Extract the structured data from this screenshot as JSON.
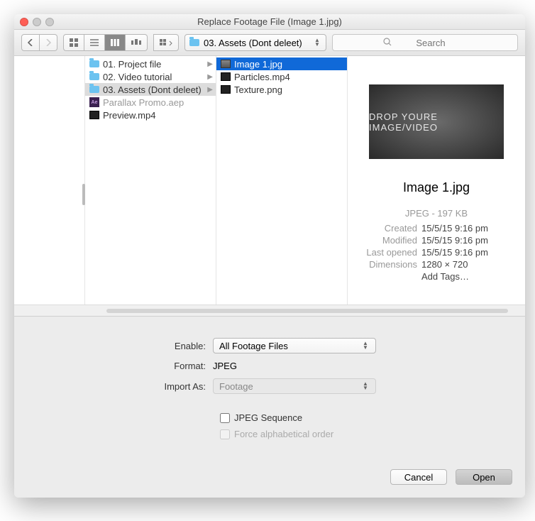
{
  "window": {
    "title": "Replace Footage File (Image 1.jpg)"
  },
  "toolbar": {
    "path_label": "03. Assets (Dont deleet)",
    "search_placeholder": "Search"
  },
  "cols": {
    "c1": {
      "items": [
        {
          "label": "01. Project file",
          "type": "folder"
        },
        {
          "label": "02. Video tutorial",
          "type": "folder"
        },
        {
          "label": "03. Assets (Dont deleet)",
          "type": "folder",
          "selected": true
        },
        {
          "label": "Parallax Promo.aep",
          "type": "aep"
        },
        {
          "label": "Preview.mp4",
          "type": "mov"
        }
      ]
    },
    "c2": {
      "items": [
        {
          "label": "Image 1.jpg",
          "type": "img",
          "highlight": true
        },
        {
          "label": "Particles.mp4",
          "type": "mov"
        },
        {
          "label": "Texture.png",
          "type": "img"
        }
      ]
    }
  },
  "preview": {
    "thumb_text": "DROP YOURE IMAGE/VIDEO",
    "filename": "Image 1.jpg",
    "type_size": "JPEG - 197 KB",
    "created_k": "Created",
    "created_v": "15/5/15 9:16 pm",
    "modified_k": "Modified",
    "modified_v": "15/5/15 9:16 pm",
    "lastopened_k": "Last opened",
    "lastopened_v": "15/5/15 9:16 pm",
    "dimensions_k": "Dimensions",
    "dimensions_v": "1280 × 720",
    "addtags": "Add Tags…"
  },
  "options": {
    "enable_label": "Enable:",
    "enable_value": "All Footage Files",
    "format_label": "Format:",
    "format_value": "JPEG",
    "importas_label": "Import As:",
    "importas_value": "Footage",
    "seq_label": "JPEG Sequence",
    "alpha_label": "Force alphabetical order"
  },
  "footer": {
    "cancel": "Cancel",
    "open": "Open"
  }
}
